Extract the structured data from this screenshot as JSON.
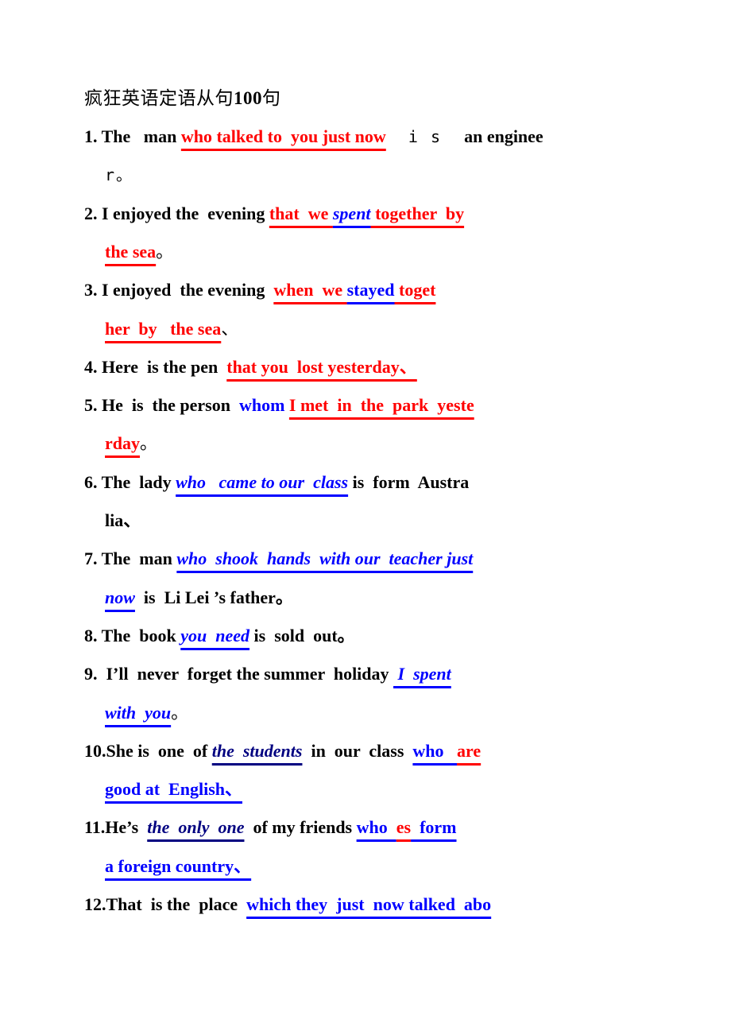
{
  "title": {
    "text": "疯狂英语定语从句",
    "number": "100",
    "suffix": "句"
  },
  "colors": {
    "red": "#ff0000",
    "blue": "#0000ff",
    "navy": "#000080",
    "black": "#000000"
  },
  "lines": [
    {
      "top": 0,
      "segs": [
        {
          "t": "1. The",
          "s": "b"
        },
        {
          "t": "   "
        },
        {
          "t": "man",
          "s": "b-mix"
        },
        {
          "t": " "
        },
        {
          "t": "who talked to  you just now",
          "s": "b",
          "c": "red",
          "u": "red"
        },
        {
          "t": "  i s  ",
          "s": "thin"
        },
        {
          "t": "an enginee",
          "s": "b"
        }
      ]
    },
    {
      "cont": true,
      "segs": [
        {
          "t": "r。",
          "s": "thin"
        }
      ]
    },
    {
      "segs": [
        {
          "t": "2. I enjoyed the  evening ",
          "s": "b"
        },
        {
          "t": "that  we ",
          "s": "b",
          "c": "red",
          "u": "red"
        },
        {
          "t": "spent",
          "s": "bi",
          "c": "blue",
          "u": "blue"
        },
        {
          "t": " together  by",
          "s": "b",
          "c": "red",
          "u": "red"
        }
      ]
    },
    {
      "cont": true,
      "segs": [
        {
          "t": "the sea",
          "s": "b",
          "c": "red",
          "u": "red"
        },
        {
          "t": "。"
        }
      ]
    },
    {
      "segs": [
        {
          "t": "3. I enjoyed  the evening  ",
          "s": "b"
        },
        {
          "t": "when  we ",
          "s": "b",
          "c": "red",
          "u": "red"
        },
        {
          "t": "stayed",
          "s": "b",
          "c": "blue",
          "u": "blue"
        },
        {
          "t": " toget",
          "s": "b",
          "c": "red",
          "u": "red"
        }
      ]
    },
    {
      "cont": true,
      "segs": [
        {
          "t": "her  by   the sea",
          "s": "b",
          "c": "red",
          "u": "red"
        },
        {
          "t": "、"
        }
      ]
    },
    {
      "segs": [
        {
          "t": "4. Here  is the pen  ",
          "s": "b"
        },
        {
          "t": "that you  lost yesterday、",
          "s": "b",
          "c": "red",
          "u": "red"
        }
      ]
    },
    {
      "segs": [
        {
          "t": "5. He  is  the person  ",
          "s": "b"
        },
        {
          "t": "whom",
          "s": "b",
          "c": "blue"
        },
        {
          "t": " "
        },
        {
          "t": "I met  in  the  park  yeste",
          "s": "b",
          "c": "red",
          "u": "red"
        }
      ]
    },
    {
      "cont": true,
      "segs": [
        {
          "t": "rday",
          "s": "b",
          "c": "red",
          "u": "red"
        },
        {
          "t": "。"
        }
      ]
    },
    {
      "segs": [
        {
          "t": "6. The  lady ",
          "s": "b"
        },
        {
          "t": "who   came to our  class",
          "s": "bi",
          "c": "blue",
          "u": "blue"
        },
        {
          "t": " is  form  Austra",
          "s": "b"
        }
      ]
    },
    {
      "cont": true,
      "segs": [
        {
          "t": "lia、",
          "s": "b"
        }
      ]
    },
    {
      "segs": [
        {
          "t": "7. The  man ",
          "s": "b"
        },
        {
          "t": "who  shook  hands  with our  teacher just",
          "s": "bi",
          "c": "blue",
          "u": "blue"
        }
      ]
    },
    {
      "cont": true,
      "segs": [
        {
          "t": "now",
          "s": "bi",
          "c": "blue",
          "u": "blue"
        },
        {
          "t": "  is  Li Lei ’s father。",
          "s": "b"
        }
      ]
    },
    {
      "segs": [
        {
          "t": "8. The  book ",
          "s": "b"
        },
        {
          "t": "you  need",
          "s": "bi",
          "c": "blue",
          "u": "blue"
        },
        {
          "t": " is  sold  out。",
          "s": "b"
        }
      ]
    },
    {
      "segs": [
        {
          "t": "9.  I’ll  never  forget the summer  holiday ",
          "s": "b"
        },
        {
          "t": " I  spent",
          "s": "bi",
          "c": "blue",
          "u": "blue"
        }
      ]
    },
    {
      "cont": true,
      "segs": [
        {
          "t": "with  you",
          "s": "bi",
          "c": "blue",
          "u": "blue"
        },
        {
          "t": "。"
        }
      ]
    },
    {
      "segs": [
        {
          "t": "10.She is  one  of ",
          "s": "b"
        },
        {
          "t": "the  students",
          "s": "bi",
          "c": "navy",
          "u": "navy"
        },
        {
          "t": "  in  our  class  ",
          "s": "b"
        },
        {
          "t": "who   ",
          "s": "b",
          "c": "blue",
          "u": "blue"
        },
        {
          "t": "are",
          "s": "b",
          "c": "red",
          "u": "red"
        }
      ]
    },
    {
      "cont": true,
      "segs": [
        {
          "t": "good at  English、",
          "s": "b",
          "c": "blue",
          "u": "blue"
        }
      ]
    },
    {
      "segs": [
        {
          "t": "11.He’s  ",
          "s": "b"
        },
        {
          "t": "the  only  one",
          "s": "bi",
          "c": "navy",
          "u": "navy"
        },
        {
          "t": "  of my friends ",
          "s": "b"
        },
        {
          "t": "who  ",
          "s": "b",
          "c": "blue",
          "u": "blue"
        },
        {
          "t": "es",
          "s": "b",
          "c": "red",
          "u": "red"
        },
        {
          "t": "  form",
          "s": "b",
          "c": "blue",
          "u": "blue"
        }
      ]
    },
    {
      "cont": true,
      "segs": [
        {
          "t": "a foreign country、",
          "s": "b",
          "c": "blue",
          "u": "blue"
        }
      ]
    },
    {
      "segs": [
        {
          "t": "12.That  is the  place  ",
          "s": "b"
        },
        {
          "t": "which they  just  now talked  abo",
          "s": "b",
          "c": "blue",
          "u": "blue"
        }
      ]
    }
  ]
}
